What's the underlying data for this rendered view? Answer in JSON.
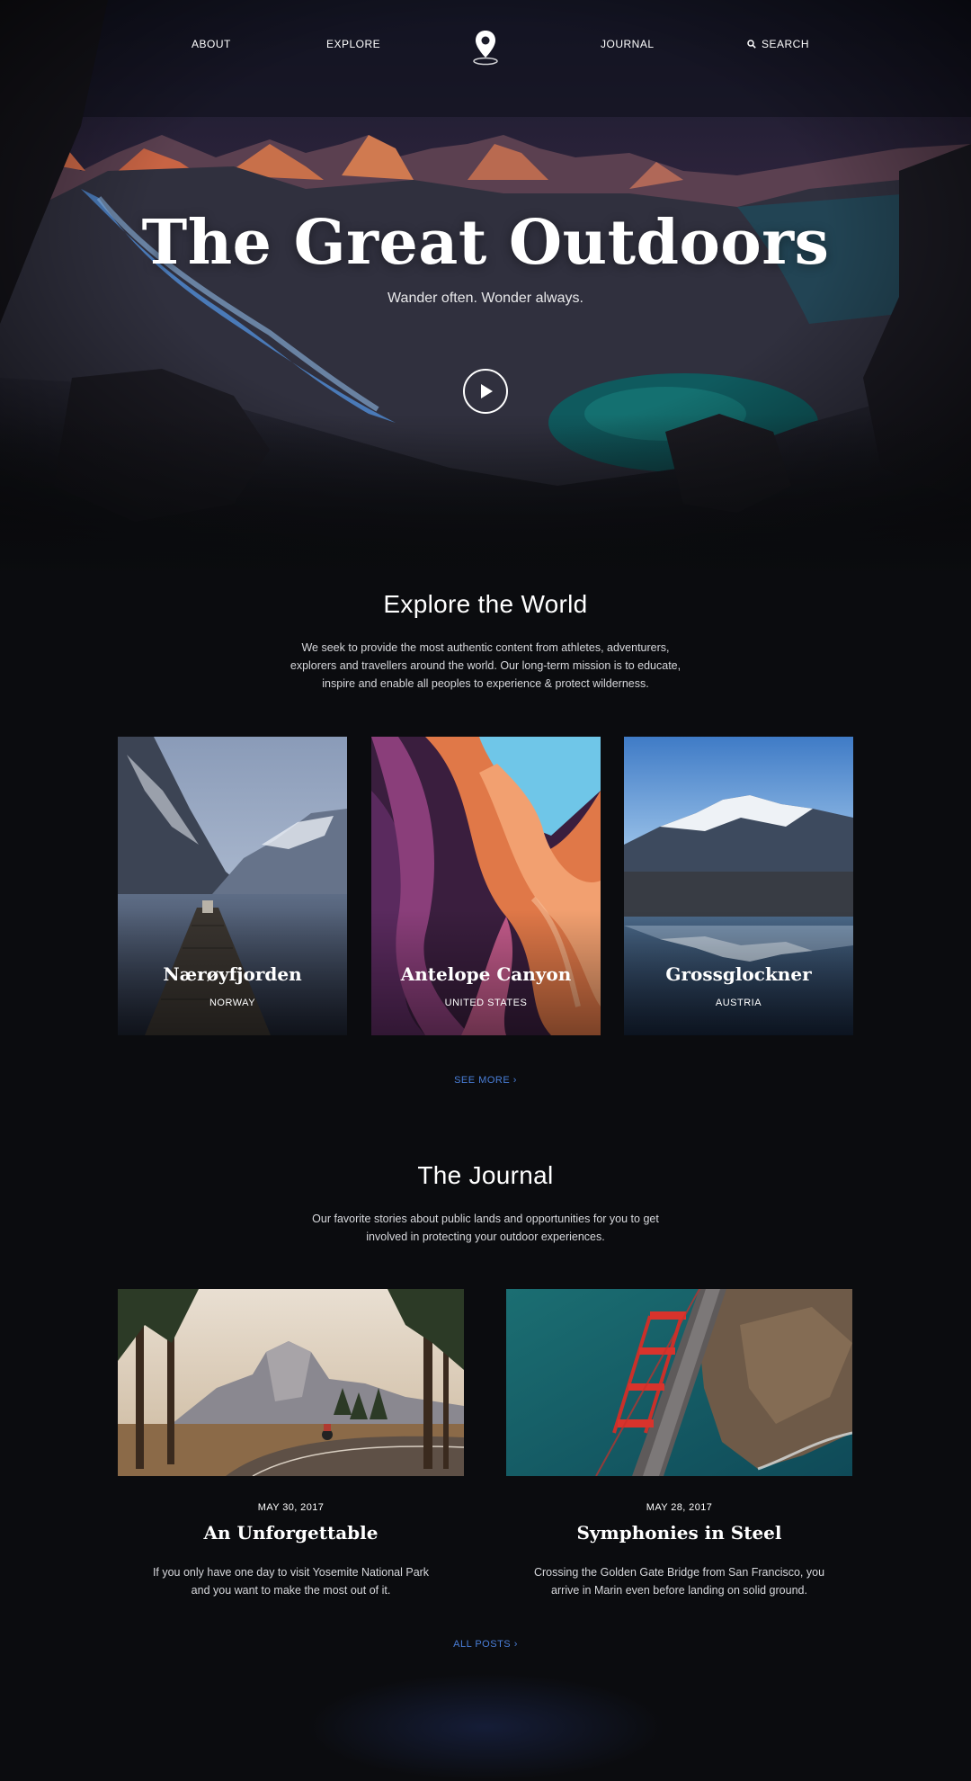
{
  "nav": {
    "about": "ABOUT",
    "explore": "EXPLORE",
    "journal": "JOURNAL",
    "search": "SEARCH",
    "logo_icon": "map-pin-icon",
    "search_icon": "search-icon"
  },
  "hero": {
    "title": "The Great Outdoors",
    "subtitle": "Wander often. Wonder always.",
    "play_icon": "play-icon"
  },
  "explore": {
    "title": "Explore the World",
    "text_lines": [
      "We seek to provide the most authentic content from athletes, adventurers,",
      "explorers and travellers around the world. Our long-term mission is to educate,",
      "inspire and enable all peoples to experience & protect wilderness."
    ],
    "destinations": [
      {
        "name": "Nærøyfjorden",
        "country": "NORWAY"
      },
      {
        "name": "Antelope Canyon",
        "country": "UNITED STATES"
      },
      {
        "name": "Grossglockner",
        "country": "AUSTRIA"
      }
    ],
    "see_more": "SEE MORE",
    "chevron": "›"
  },
  "journal": {
    "title": "The Journal",
    "text_lines": [
      "Our favorite stories about public lands and opportunities for you to get",
      "involved in protecting your outdoor experiences."
    ],
    "posts": [
      {
        "date": "MAY 30, 2017",
        "title": "An Unforgettable",
        "text_lines": [
          "If you only have one day to visit Yosemite National Park",
          "and you want to make the most out of it."
        ]
      },
      {
        "date": "MAY 28, 2017",
        "title": "Symphonies in Steel",
        "text_lines": [
          "Crossing the Golden Gate Bridge from San Francisco, you",
          "arrive in Marin even before landing on solid ground."
        ]
      }
    ],
    "all_posts": "ALL POSTS",
    "chevron": "›"
  },
  "colors": {
    "background": "#0b0c0f",
    "link_accent": "#4a7fd9",
    "text_muted": "#d7d8dc"
  }
}
